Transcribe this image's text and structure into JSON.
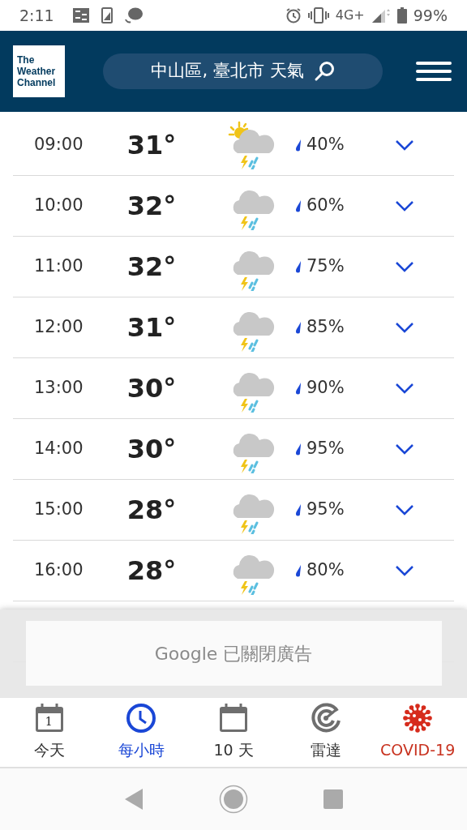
{
  "status_bar": {
    "time": "2:11",
    "network": "4G+",
    "battery": "99%"
  },
  "header": {
    "logo": [
      "The",
      "Weather",
      "Channel"
    ],
    "search": "中山區, 臺北市 天氣"
  },
  "hours": [
    {
      "time": "09:00",
      "temp": "31°",
      "kind": "sun-storm",
      "precip": "40%"
    },
    {
      "time": "10:00",
      "temp": "32°",
      "kind": "storm",
      "precip": "60%"
    },
    {
      "time": "11:00",
      "temp": "32°",
      "kind": "storm",
      "precip": "75%"
    },
    {
      "time": "12:00",
      "temp": "31°",
      "kind": "storm",
      "precip": "85%"
    },
    {
      "time": "13:00",
      "temp": "30°",
      "kind": "storm",
      "precip": "90%"
    },
    {
      "time": "14:00",
      "temp": "30°",
      "kind": "storm",
      "precip": "95%"
    },
    {
      "time": "15:00",
      "temp": "28°",
      "kind": "storm",
      "precip": "95%"
    },
    {
      "time": "16:00",
      "temp": "28°",
      "kind": "storm",
      "precip": "80%"
    }
  ],
  "ad_notice": "Google 已關閉廣告",
  "nav": [
    {
      "kind": "today",
      "label": "今天",
      "day": "1",
      "selected": false,
      "color": "#333333"
    },
    {
      "kind": "clock",
      "label": "每小時",
      "selected": true,
      "color": "#1a47d6"
    },
    {
      "kind": "calendar",
      "label": "10 天",
      "selected": false,
      "color": "#333333"
    },
    {
      "kind": "radar",
      "label": "雷達",
      "selected": false,
      "color": "#333333"
    },
    {
      "kind": "virus",
      "label": "COVID-19",
      "selected": false,
      "color": "#c8321f"
    }
  ]
}
